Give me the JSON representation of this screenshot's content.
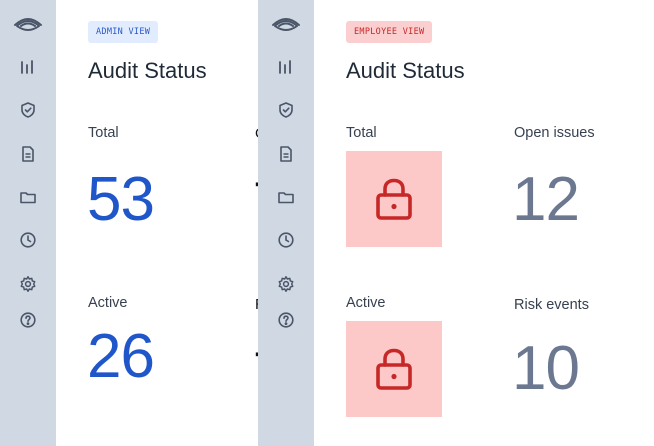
{
  "panels": {
    "admin": {
      "badge": "ADMIN VIEW",
      "title": "Audit Status",
      "metrics": [
        {
          "label": "Total",
          "value": "53"
        },
        {
          "label": "Active",
          "value": "26"
        }
      ]
    },
    "employee": {
      "badge": "EMPLOYEE VIEW",
      "title": "Audit Status",
      "metrics": [
        {
          "label": "Total",
          "locked": true
        },
        {
          "label": "Open issues",
          "value": "12"
        },
        {
          "label": "Active",
          "locked": true
        },
        {
          "label": "Risk events",
          "value": "10"
        }
      ]
    }
  },
  "sidebar": {
    "icons": [
      "eye-logo-icon",
      "bar-chart-icon",
      "shield-check-icon",
      "document-icon",
      "folder-icon",
      "clock-icon",
      "gear-icon",
      "help-icon"
    ]
  },
  "colors": {
    "sidebar_bg": "#cfd8e3",
    "admin_value": "#1f56c9",
    "employee_value": "#6b7890",
    "lock_tile": "#fcc8c8",
    "lock_icon": "#c62828"
  }
}
